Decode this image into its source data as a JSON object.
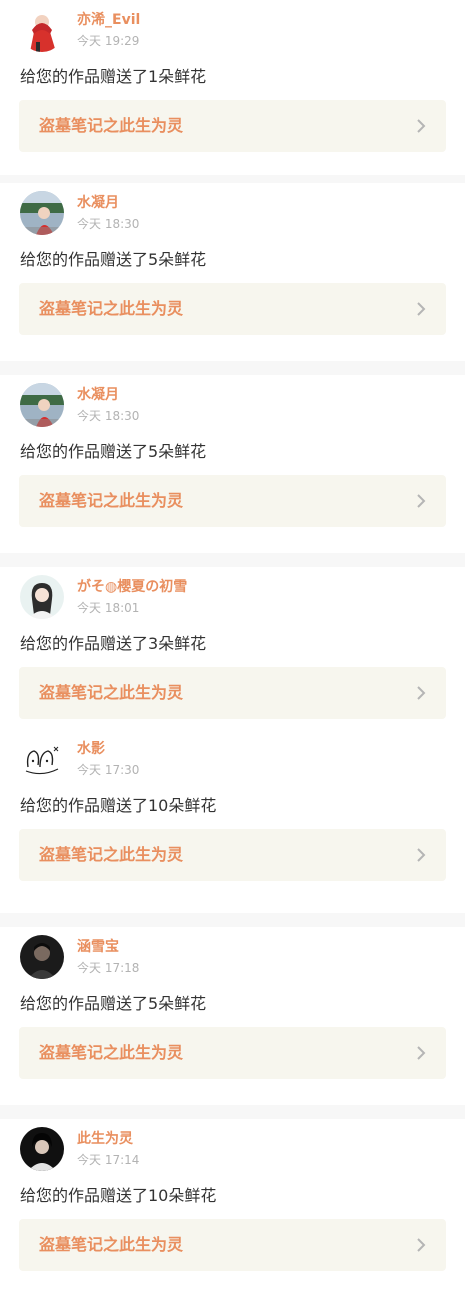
{
  "notifications": [
    {
      "avatar": "avatar-red-jacket",
      "user": "亦浠_Evil",
      "time": "今天 19:29",
      "message": "给您的作品赠送了1朵鲜花",
      "work_title": "盗墓笔记之此生为灵"
    },
    {
      "avatar": "avatar-red-dress-outdoor",
      "user": "水凝月",
      "time": "今天 18:30",
      "message": "给您的作品赠送了5朵鲜花",
      "work_title": "盗墓笔记之此生为灵"
    },
    {
      "avatar": "avatar-red-dress-outdoor",
      "user": "水凝月",
      "time": "今天 18:30",
      "message": "给您的作品赠送了5朵鲜花",
      "work_title": "盗墓笔记之此生为灵"
    },
    {
      "avatar": "avatar-girl-light",
      "user": "がそ◍櫻夏の初雪",
      "time": "今天 18:01",
      "message": "给您的作品赠送了3朵鲜花",
      "work_title": "盗墓笔记之此生为灵"
    },
    {
      "avatar": "avatar-doodle-bunny",
      "user": "水影",
      "time": "今天 17:30",
      "message": "给您的作品赠送了10朵鲜花",
      "work_title": "盗墓笔记之此生为灵"
    },
    {
      "avatar": "avatar-dark-portrait",
      "user": "涵雪宝",
      "time": "今天 17:18",
      "message": "给您的作品赠送了5朵鲜花",
      "work_title": "盗墓笔记之此生为灵"
    },
    {
      "avatar": "avatar-dark-portrait-2",
      "user": "此生为灵",
      "time": "今天 17:14",
      "message": "给您的作品赠送了10朵鲜花",
      "work_title": "盗墓笔记之此生为灵"
    }
  ],
  "colors": {
    "accent": "#e98f5f",
    "work_bg": "#f7f6ee",
    "page_bg": "#f7f7f7",
    "text": "#333333",
    "muted": "#b3b3b3"
  }
}
